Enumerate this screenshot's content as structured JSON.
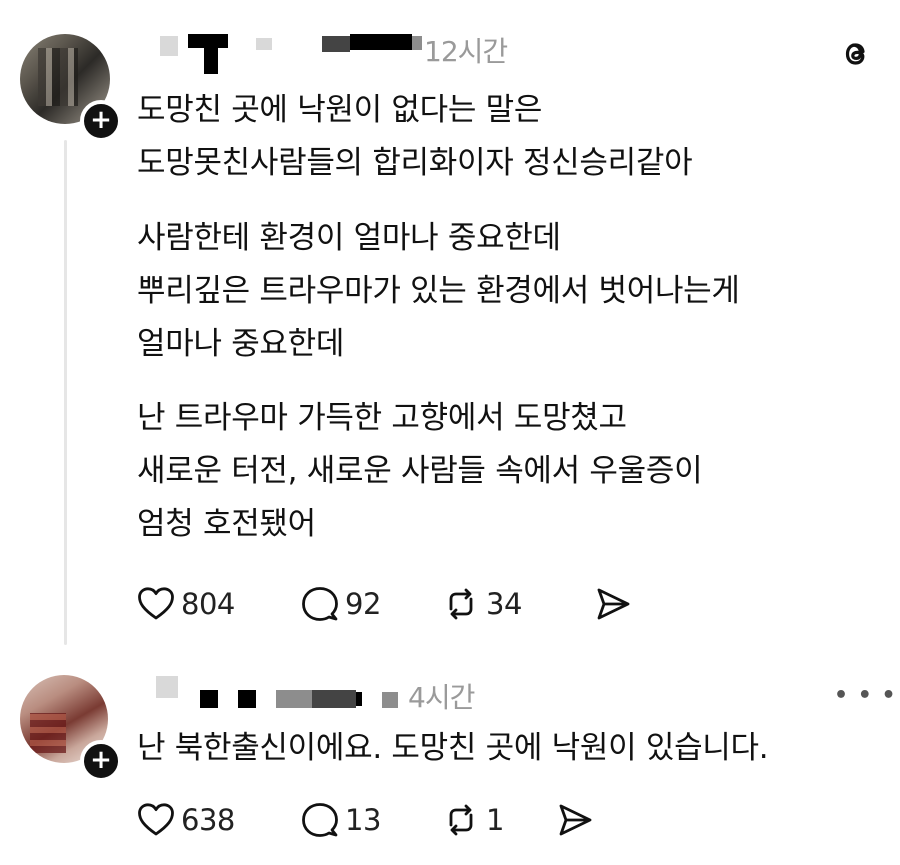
{
  "post": {
    "timestamp": "12시간",
    "paragraphs": [
      [
        "도망친 곳에 낙원이 없다는 말은",
        "도망못친사람들의 합리화이자 정신승리같아"
      ],
      [
        "사람한테 환경이 얼마나 중요한데",
        "뿌리깊은 트라우마가 있는 환경에서 벗어나는게",
        "얼마나 중요한데"
      ],
      [
        "난 트라우마 가득한 고향에서 도망쳤고",
        "새로운 터전, 새로운 사람들 속에서 우울증이",
        "엄청 호전됐어"
      ]
    ],
    "likes": "804",
    "replies": "92",
    "reposts": "34"
  },
  "reply": {
    "timestamp": "4시간",
    "text": "난 북한출신이에요. 도망친 곳에 낙원이 있습니다.",
    "likes": "638",
    "replies": "13",
    "reposts": "1"
  },
  "icons": {
    "app_logo": "threads-logo-icon",
    "like": "heart-icon",
    "reply": "speech-bubble-icon",
    "repost": "repost-icon",
    "share": "send-icon",
    "more": "more-dots-icon",
    "follow": "plus-icon"
  }
}
